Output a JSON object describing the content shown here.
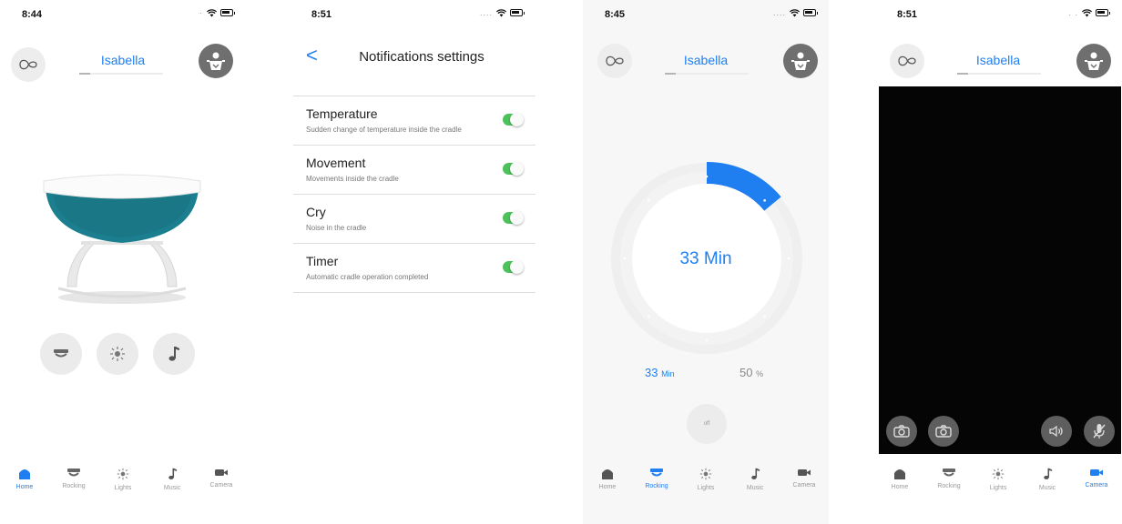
{
  "screens": {
    "home": {
      "time": "8:44",
      "baby_name": "Isabella",
      "icons": {
        "left": "cradle-logo-icon",
        "right": "baby-profile-icon"
      },
      "actions": [
        "rocking-icon",
        "lights-icon",
        "music-icon"
      ]
    },
    "notifications": {
      "time": "8:51",
      "back": "<",
      "title": "Notifications settings",
      "items": [
        {
          "title": "Temperature",
          "desc": "Sudden change of temperature inside the cradle",
          "enabled": true
        },
        {
          "title": "Movement",
          "desc": "Movements inside the cradle",
          "enabled": true
        },
        {
          "title": "Cry",
          "desc": "Noise in the cradle",
          "enabled": true
        },
        {
          "title": "Timer",
          "desc": "Automatic cradle operation completed",
          "enabled": true
        }
      ]
    },
    "rocking": {
      "time": "8:45",
      "baby_name": "Isabella",
      "dial_value": "33 Min",
      "dial_progress": 0.14,
      "duration_value": "33",
      "duration_unit": "Min",
      "intensity_value": "50",
      "intensity_unit": "%",
      "off_label": "off"
    },
    "camera": {
      "time": "8:51",
      "baby_name": "Isabella",
      "controls": [
        "camera-icon",
        "camera-icon",
        "speaker-icon",
        "mic-off-icon"
      ]
    }
  },
  "tabbar": {
    "labels": {
      "home": "Home",
      "rocking": "Rocking",
      "lights": "Lights",
      "music": "Music",
      "camera": "Camera"
    },
    "accent": "#1f7ff0",
    "inactive": "#999999"
  },
  "colors": {
    "accent": "#1f7ff0",
    "toggle_on": "#4cc35a",
    "cradle": "#1b7f8f"
  }
}
